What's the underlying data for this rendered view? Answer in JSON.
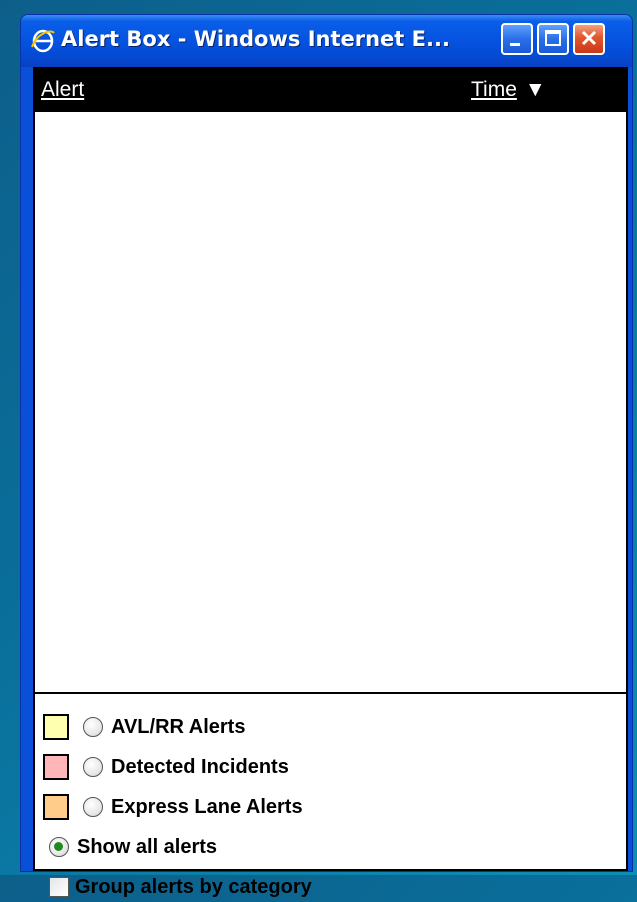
{
  "window": {
    "title": "Alert Box - Windows Internet E...",
    "icon": "ie-icon",
    "controls": [
      "minimize-icon",
      "maximize-icon",
      "close-icon"
    ]
  },
  "table": {
    "columns": {
      "alert": "Alert",
      "time": "Time",
      "sort_indicator": "▼"
    },
    "rows": []
  },
  "legend": {
    "categories": [
      {
        "label": "AVL/RR Alerts",
        "color": "#ffffb0"
      },
      {
        "label": "Detected Incidents",
        "color": "#ffb6b9"
      },
      {
        "label": "Express Lane Alerts",
        "color": "#ffcc8a"
      }
    ],
    "show_all": {
      "label": "Show all alerts",
      "selected": true
    },
    "group_by": {
      "label": "Group alerts by category",
      "checked": false
    }
  }
}
